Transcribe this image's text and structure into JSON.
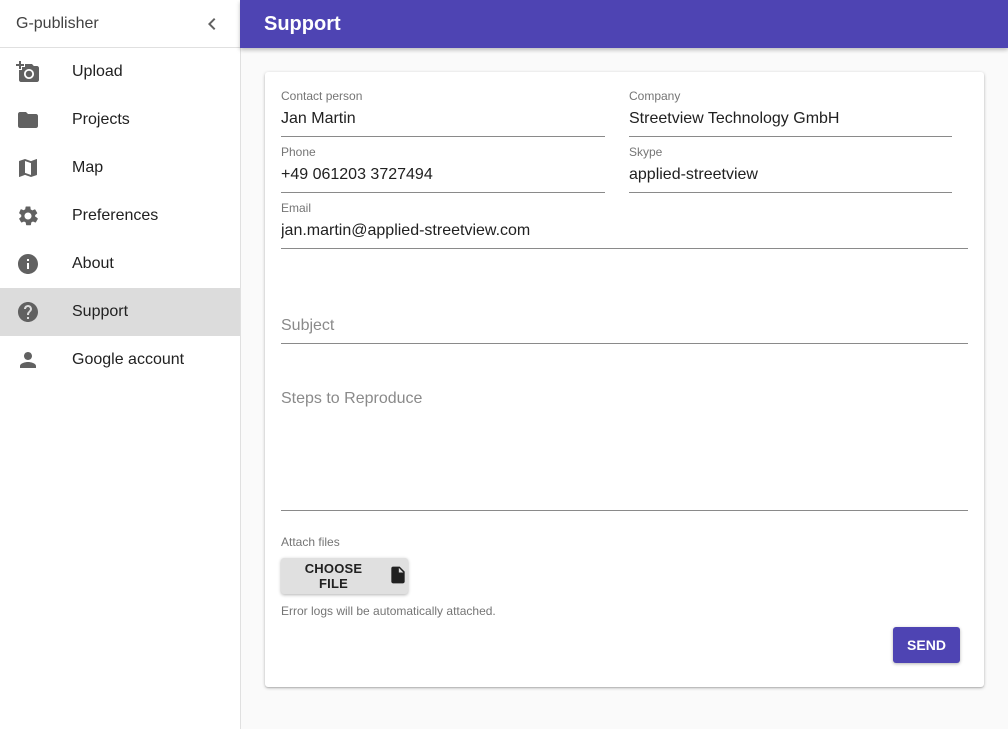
{
  "sidebar": {
    "title": "G-publisher",
    "items": [
      {
        "label": "Upload",
        "icon": "add-camera-icon"
      },
      {
        "label": "Projects",
        "icon": "folder-icon"
      },
      {
        "label": "Map",
        "icon": "map-icon"
      },
      {
        "label": "Preferences",
        "icon": "gear-icon"
      },
      {
        "label": "About",
        "icon": "info-icon"
      },
      {
        "label": "Support",
        "icon": "help-icon",
        "active": true
      },
      {
        "label": "Google account",
        "icon": "person-icon"
      }
    ]
  },
  "header": {
    "title": "Support",
    "accent_color": "#4e44b3"
  },
  "form": {
    "contact_person": {
      "label": "Contact person",
      "value": "Jan Martin"
    },
    "company": {
      "label": "Company",
      "value": "Streetview Technology GmbH"
    },
    "phone": {
      "label": "Phone",
      "value": "+49 061203 3727494"
    },
    "skype": {
      "label": "Skype",
      "value": "applied-streetview"
    },
    "email": {
      "label": "Email",
      "value": "jan.martin@applied-streetview.com"
    },
    "subject": {
      "placeholder": "Subject",
      "value": ""
    },
    "steps": {
      "placeholder": "Steps to Reproduce",
      "value": ""
    },
    "attach": {
      "label": "Attach files",
      "button_label": "CHOOSE FILE",
      "icon": "file-icon",
      "hint": "Error logs will be automatically attached."
    },
    "send_label": "SEND"
  }
}
